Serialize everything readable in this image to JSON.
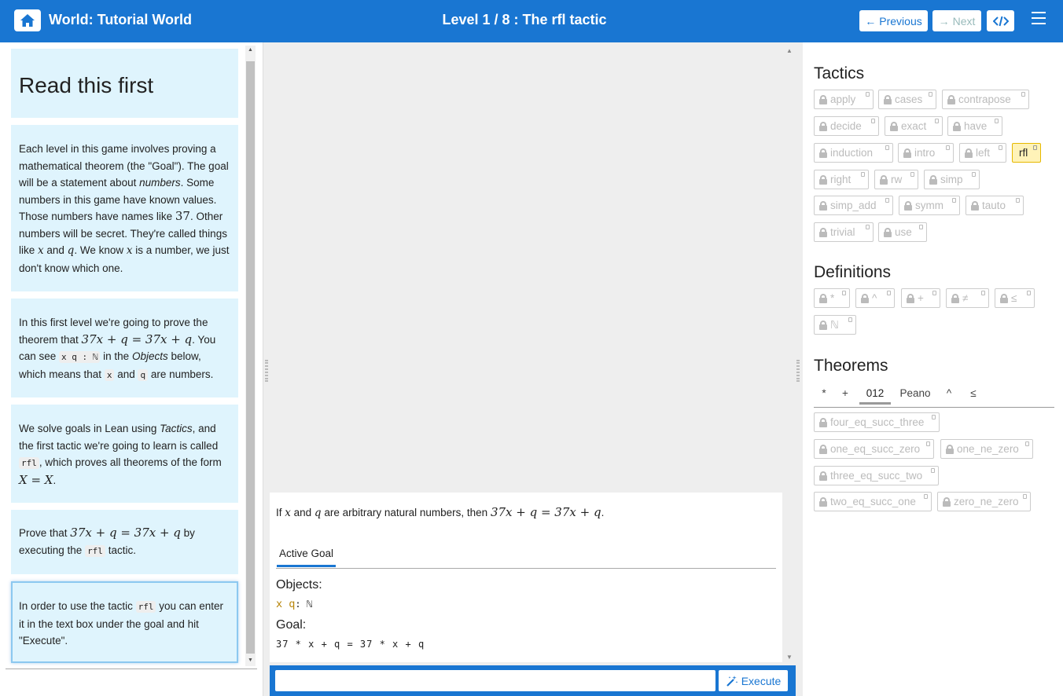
{
  "header": {
    "world_title": "World: Tutorial World",
    "level_title": "Level 1 / 8 : The rfl tactic",
    "previous_label": "Previous",
    "next_label": "Next"
  },
  "intro": {
    "heading": "Read this first",
    "p1": [
      "Each level in this game involves proving a mathematical theorem (the \"Goal\"). The goal will be a statement about ",
      "numbers",
      ". Some numbers in this game have known values. Those numbers have names like ",
      "37",
      ". Other numbers will be secret. They're called things like ",
      "x",
      " and ",
      "q",
      ". We know ",
      "x",
      " is a number, we just don't know which one."
    ],
    "p2": [
      "In this first level we're going to prove the theorem that ",
      "37x + q = 37x + q",
      ". You can see ",
      "x q : ℕ",
      " in the ",
      "Objects",
      " below, which means that ",
      "x",
      " and ",
      "q",
      " are numbers."
    ],
    "p3": [
      "We solve goals in Lean using ",
      "Tactics",
      ", and the first tactic we're going to learn is called ",
      "rfl",
      ", which proves all theorems of the form ",
      "X = X",
      "."
    ],
    "p4": [
      "Prove that ",
      "37x + q = 37x + q",
      " by executing the ",
      "rfl",
      " tactic."
    ],
    "p5": [
      "In order to use the tactic ",
      "rfl",
      " you can enter it in the text box under the goal and hit \"Execute\"."
    ]
  },
  "goal_panel": {
    "statement": [
      "If ",
      "x",
      " and ",
      "q",
      " are arbitrary natural numbers, then ",
      "37x + q = 37x + q",
      "."
    ],
    "tab_label": "Active Goal",
    "objects_label": "Objects:",
    "objects_vars": "x q",
    "objects_type": ": ℕ",
    "goal_label": "Goal:",
    "goal_expr": "37 * x + q = 37 * x + q",
    "execute_label": "Execute",
    "input_value": ""
  },
  "inventory": {
    "tactics_title": "Tactics",
    "tactics": [
      "apply",
      "cases",
      "contrapose",
      "decide",
      "exact",
      "have",
      "induction",
      "intro",
      "left",
      "rfl",
      "right",
      "rw",
      "simp",
      "simp_add",
      "symm",
      "tauto",
      "trivial",
      "use"
    ],
    "highlighted_tactic": "rfl",
    "definitions_title": "Definitions",
    "definitions": [
      "*",
      "^",
      "+",
      "≠",
      "≤",
      "ℕ"
    ],
    "theorems_title": "Theorems",
    "theorem_tabs": [
      "*",
      "+",
      "012",
      "Peano",
      "^",
      "≤"
    ],
    "active_theorem_tab": "012",
    "theorems": [
      "four_eq_succ_three",
      "one_eq_succ_zero",
      "one_ne_zero",
      "three_eq_succ_two",
      "two_eq_succ_one",
      "zero_ne_zero"
    ]
  },
  "colors": {
    "primary": "#1976d2",
    "card_bg": "#dff4fd",
    "highlight_bg": "#fff3b8",
    "object_var": "#b8860b"
  }
}
